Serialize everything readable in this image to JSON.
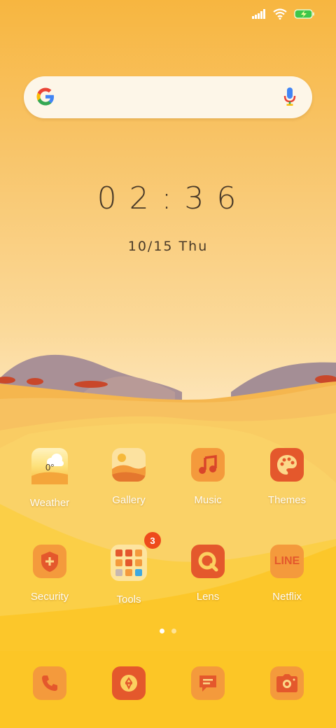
{
  "status_bar": {
    "signal_icon": "signal-icon",
    "wifi_icon": "wifi-icon",
    "battery_icon": "battery-charging-icon",
    "battery_color": "#3ec64a"
  },
  "search": {
    "logo_icon": "google-logo-icon",
    "mic_icon": "microphone-icon"
  },
  "clock": {
    "time": "02:36",
    "date": "10/15 Thu"
  },
  "apps": [
    {
      "label": "Weather",
      "icon": "weather-icon",
      "temperature": "0°"
    },
    {
      "label": "Gallery",
      "icon": "gallery-icon"
    },
    {
      "label": "Music",
      "icon": "music-icon"
    },
    {
      "label": "Themes",
      "icon": "palette-icon"
    },
    {
      "label": "Security",
      "icon": "shield-icon"
    },
    {
      "label": "Tools",
      "icon": "folder-icon",
      "badge": "3"
    },
    {
      "label": "Lens",
      "icon": "lens-icon"
    },
    {
      "label": "Netflix",
      "icon": "line-icon",
      "icon_text": "LINE"
    }
  ],
  "page_indicator": {
    "pages": 2,
    "current": 1
  },
  "dock": [
    {
      "icon": "phone-icon"
    },
    {
      "icon": "wallet-icon"
    },
    {
      "icon": "messages-icon"
    },
    {
      "icon": "camera-icon"
    }
  ],
  "colors": {
    "icon_orange": "#f49a3c",
    "icon_red": "#e4582c",
    "text_dark": "#4a3a28"
  }
}
